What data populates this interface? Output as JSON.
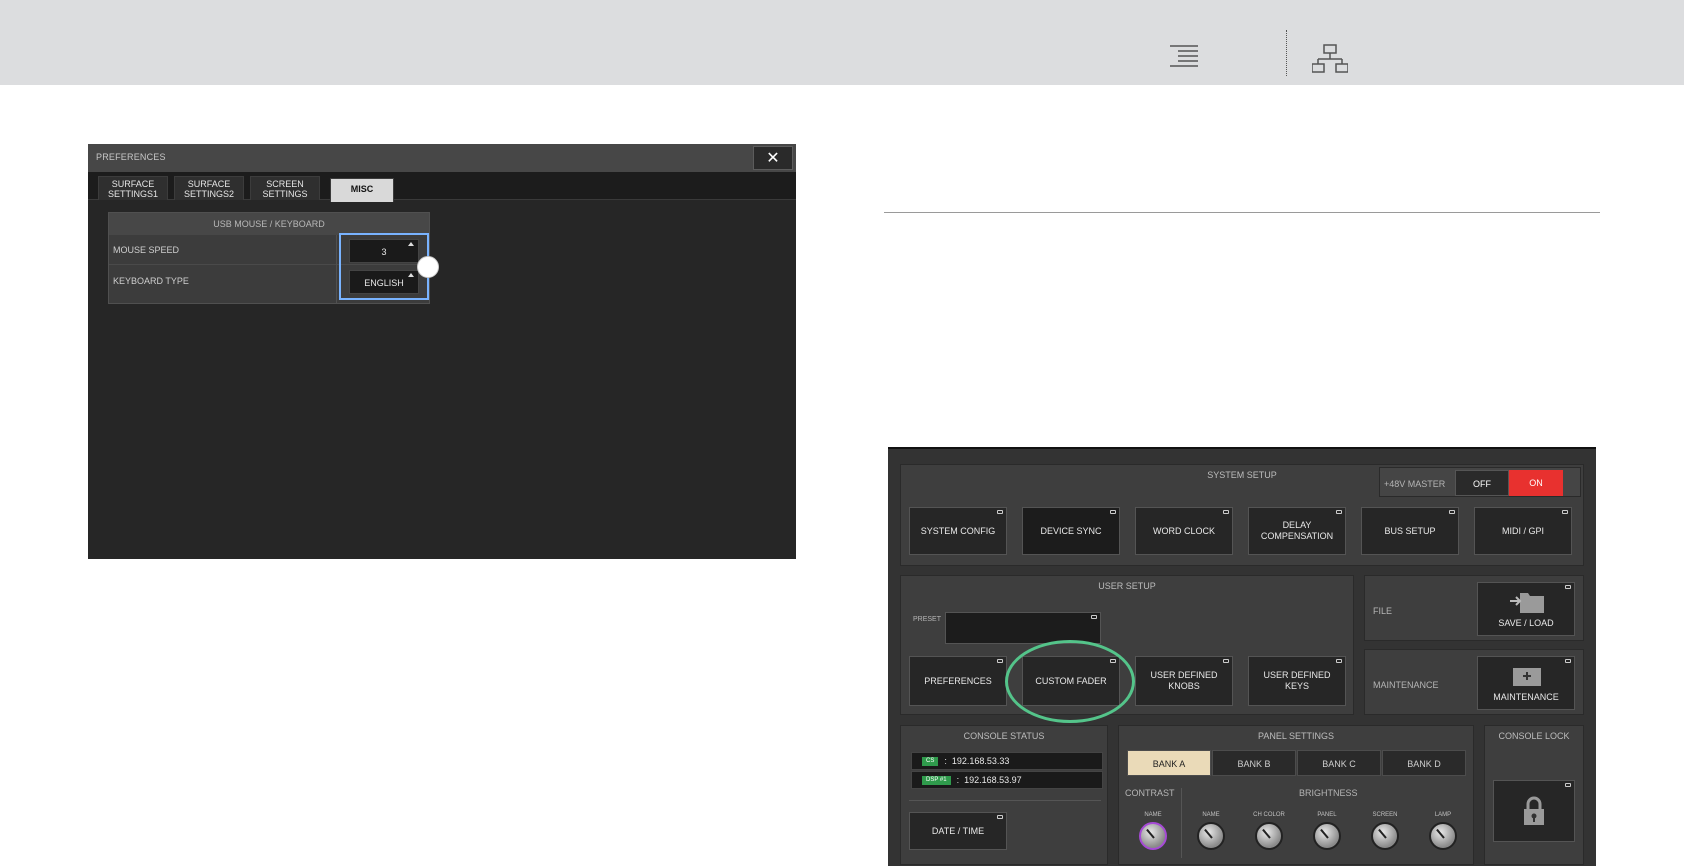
{
  "topbar": {
    "icons": [
      "align-right-lines-icon",
      "sitemap-icon"
    ]
  },
  "preferences": {
    "title": "PREFERENCES",
    "close_label": "✕",
    "tabs": [
      {
        "label": "SURFACE\nSETTINGS1"
      },
      {
        "label": "SURFACE\nSETTINGS2"
      },
      {
        "label": "SCREEN\nSETTINGS"
      },
      {
        "label": "MISC",
        "active": true
      }
    ],
    "usb_panel": {
      "title": "USB MOUSE / KEYBOARD",
      "mouse_speed_label": "MOUSE SPEED",
      "mouse_speed_value": "3",
      "keyboard_type_label": "KEYBOARD TYPE",
      "keyboard_type_value": "ENGLISH"
    }
  },
  "setup": {
    "system_setup": {
      "title": "SYSTEM SETUP",
      "phantom_label": "+48V MASTER",
      "off_label": "OFF",
      "on_label": "ON",
      "buttons": [
        "SYSTEM CONFIG",
        "DEVICE SYNC",
        "WORD CLOCK",
        "DELAY\nCOMPENSATION",
        "BUS SETUP",
        "MIDI / GPI"
      ]
    },
    "user_setup": {
      "title": "USER SETUP",
      "preset_label": "PRESET",
      "buttons": [
        "PREFERENCES",
        "CUSTOM FADER",
        "USER DEFINED\nKNOBS",
        "USER DEFINED\nKEYS"
      ]
    },
    "file": {
      "label": "FILE",
      "button": "SAVE / LOAD"
    },
    "maintenance": {
      "label": "MAINTENANCE",
      "button": "MAINTENANCE"
    },
    "console_status": {
      "title": "CONSOLE STATUS",
      "rows": [
        {
          "chip": "CS",
          "ip": "192.168.53.33"
        },
        {
          "chip": "DSP #1",
          "ip": "192.168.53.97"
        }
      ],
      "separator": ":",
      "date_time_button": "DATE / TIME"
    },
    "panel_settings": {
      "title": "PANEL SETTINGS",
      "banks": [
        "BANK A",
        "BANK B",
        "BANK C",
        "BANK D"
      ],
      "contrast_label": "CONTRAST",
      "brightness_label": "BRIGHTNESS",
      "contrast_knobs": [
        "NAME"
      ],
      "brightness_knobs": [
        "NAME",
        "CH COLOR",
        "PANEL",
        "SCREEN",
        "LAMP"
      ]
    },
    "console_lock": {
      "title": "CONSOLE LOCK"
    }
  },
  "colors": {
    "highlight_blue": "#79b3ff",
    "callout_green": "#54c48a",
    "on_red": "#e8312f"
  }
}
